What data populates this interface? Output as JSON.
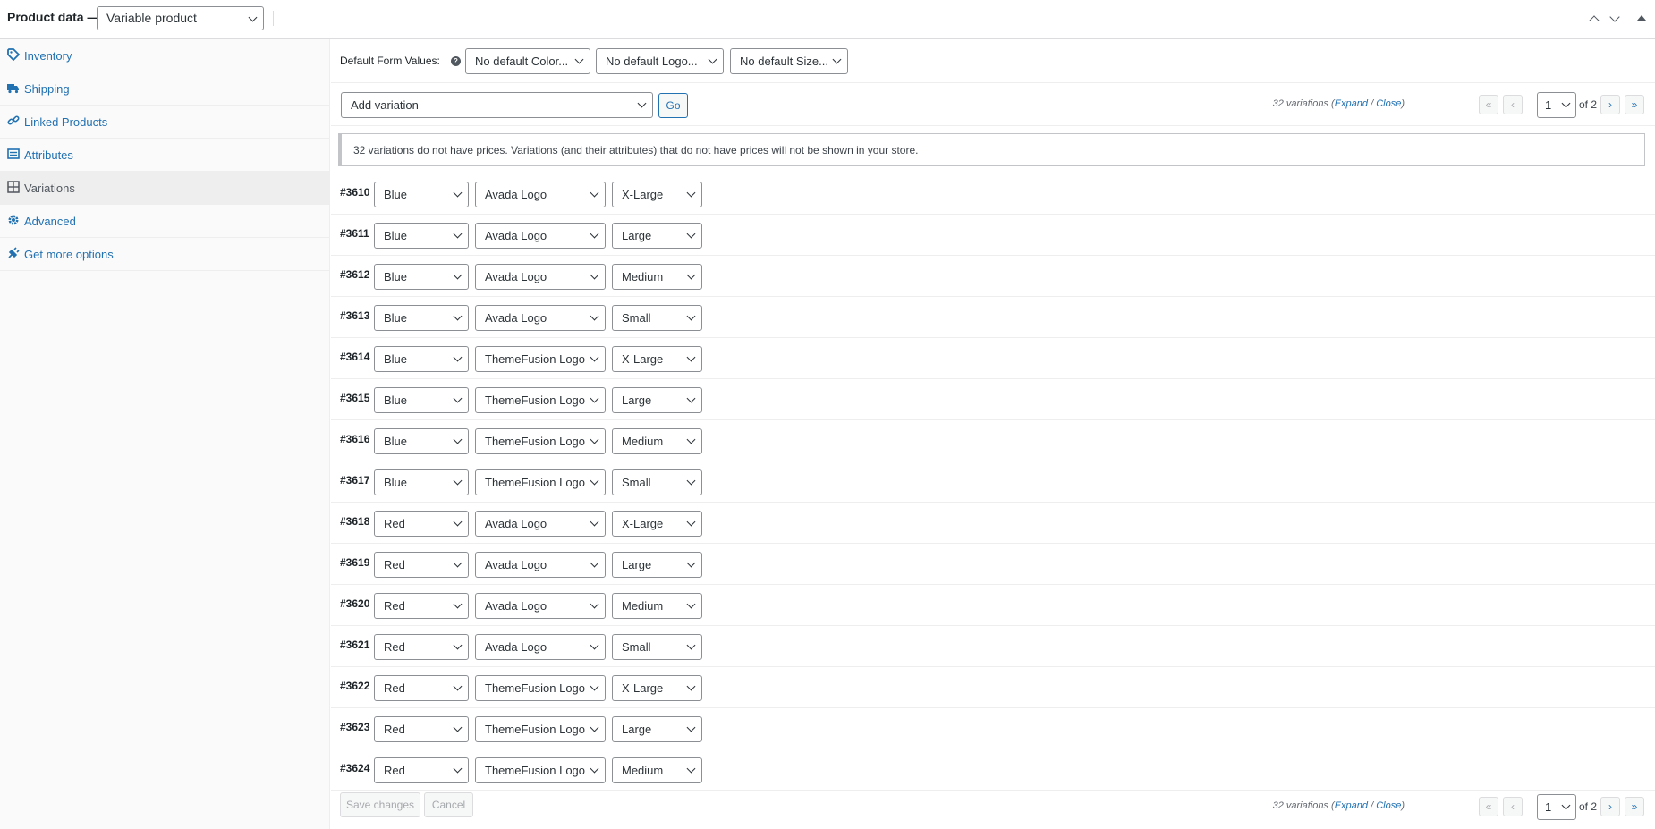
{
  "header": {
    "title": "Product data —",
    "product_type": "Variable product"
  },
  "sidebar": {
    "items": [
      {
        "label": "Inventory",
        "icon": "tag-icon"
      },
      {
        "label": "Shipping",
        "icon": "truck-icon"
      },
      {
        "label": "Linked Products",
        "icon": "link-icon"
      },
      {
        "label": "Attributes",
        "icon": "list-icon"
      },
      {
        "label": "Variations",
        "icon": "grid-icon",
        "active": true
      },
      {
        "label": "Advanced",
        "icon": "gear-icon"
      },
      {
        "label": "Get more options",
        "icon": "plugin-icon"
      }
    ]
  },
  "defaults": {
    "label": "Default Form Values:",
    "help": "?",
    "color": "No default Color...",
    "logo": "No default Logo...",
    "size": "No default Size..."
  },
  "actions": {
    "add_variation": "Add variation",
    "go": "Go"
  },
  "pagination": {
    "count_text": "32 variations",
    "open_paren": "(",
    "expand": "Expand",
    "slash": " / ",
    "close": "Close",
    "close_paren": ")",
    "first": "«",
    "prev": "‹",
    "page": "1",
    "of": "of 2",
    "next": "›",
    "last": "»"
  },
  "notice": "32 variations do not have prices. Variations (and their attributes) that do not have prices will not be shown in your store.",
  "variations": [
    {
      "id": "#3610",
      "color": "Blue",
      "logo": "Avada Logo",
      "size": "X-Large"
    },
    {
      "id": "#3611",
      "color": "Blue",
      "logo": "Avada Logo",
      "size": "Large"
    },
    {
      "id": "#3612",
      "color": "Blue",
      "logo": "Avada Logo",
      "size": "Medium"
    },
    {
      "id": "#3613",
      "color": "Blue",
      "logo": "Avada Logo",
      "size": "Small"
    },
    {
      "id": "#3614",
      "color": "Blue",
      "logo": "ThemeFusion Logo",
      "size": "X-Large"
    },
    {
      "id": "#3615",
      "color": "Blue",
      "logo": "ThemeFusion Logo",
      "size": "Large"
    },
    {
      "id": "#3616",
      "color": "Blue",
      "logo": "ThemeFusion Logo",
      "size": "Medium"
    },
    {
      "id": "#3617",
      "color": "Blue",
      "logo": "ThemeFusion Logo",
      "size": "Small"
    },
    {
      "id": "#3618",
      "color": "Red",
      "logo": "Avada Logo",
      "size": "X-Large"
    },
    {
      "id": "#3619",
      "color": "Red",
      "logo": "Avada Logo",
      "size": "Large"
    },
    {
      "id": "#3620",
      "color": "Red",
      "logo": "Avada Logo",
      "size": "Medium"
    },
    {
      "id": "#3621",
      "color": "Red",
      "logo": "Avada Logo",
      "size": "Small"
    },
    {
      "id": "#3622",
      "color": "Red",
      "logo": "ThemeFusion Logo",
      "size": "X-Large"
    },
    {
      "id": "#3623",
      "color": "Red",
      "logo": "ThemeFusion Logo",
      "size": "Large"
    },
    {
      "id": "#3624",
      "color": "Red",
      "logo": "ThemeFusion Logo",
      "size": "Medium"
    }
  ],
  "footer": {
    "save": "Save changes",
    "cancel": "Cancel"
  },
  "colors": {
    "link": "#2271b1",
    "text": "#1d2327",
    "border": "#8c8f94",
    "sidebar_bg": "#fafafa",
    "active_bg": "#eeeeee"
  }
}
